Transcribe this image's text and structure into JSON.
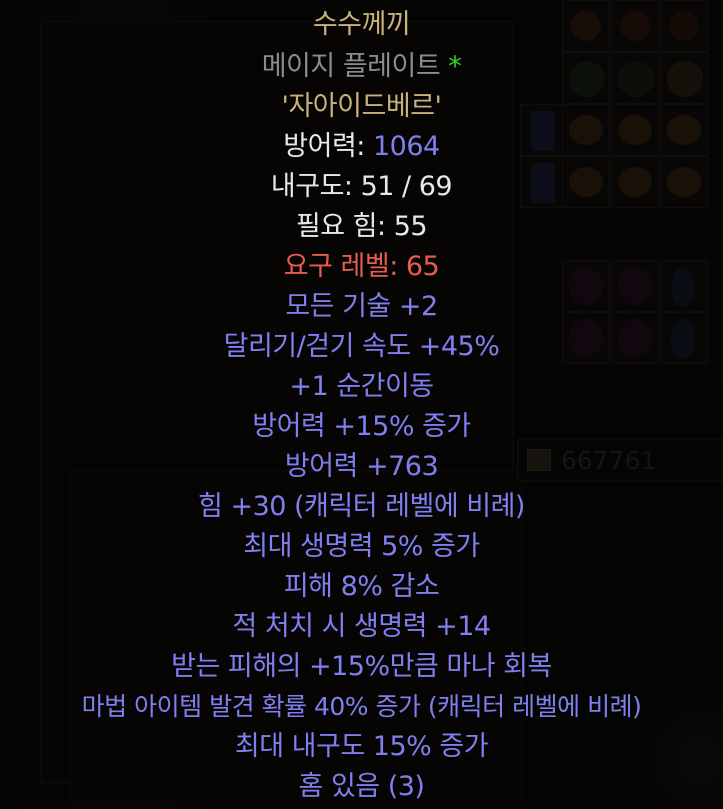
{
  "item": {
    "name": "수수께끼",
    "base_type": "메이지 플레이트",
    "ethereal_marker": "*",
    "rune_word": "'자아이드베르'",
    "defense_label": "방어력: ",
    "defense_value": "1064",
    "durability_label": "내구도: ",
    "durability_value": "51 / 69",
    "required_strength": "필요 힘: 55",
    "required_level": "요구 레벨: 65",
    "mods": [
      "모든 기술 +2",
      "달리기/걷기 속도 +45%",
      "+1 순간이동",
      "방어력 +15% 증가",
      "방어력 +763",
      "힘 +30 (캐릭터 레벨에 비례)",
      "최대 생명력 5% 증가",
      "피해 8% 감소",
      "적 처치 시 생명력 +14",
      "받는 피해의 +15%만큼 마나 회복",
      "마법 아이템 발견 확률 40% 증가 (캐릭터 레벨에 비례)",
      "최대 내구도 15% 증가",
      "홈 있음 (3)"
    ]
  },
  "stash": {
    "gold": "667761"
  },
  "colors": {
    "unique_gold": "#c9b17a",
    "base_grey": "#8c8c8c",
    "magic_blue": "#7f7ff0",
    "requirement_red": "#e85b50",
    "ethereal_green": "#2fd62f"
  }
}
